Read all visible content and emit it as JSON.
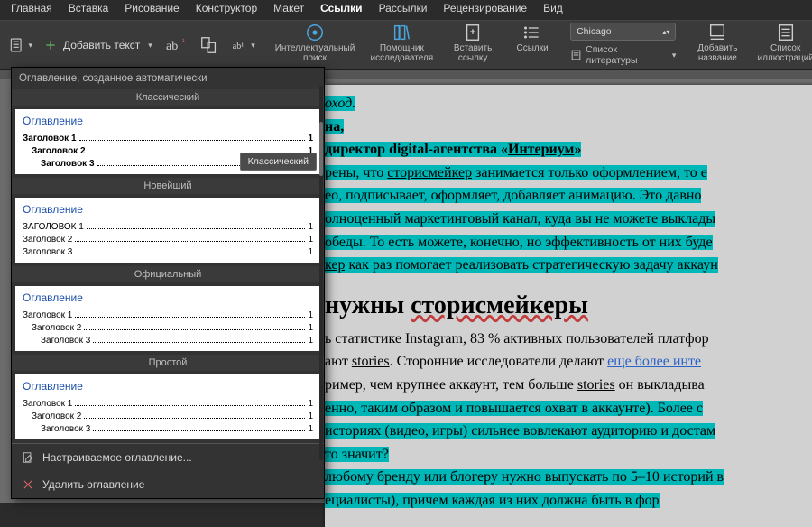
{
  "menubar": {
    "items": [
      "Главная",
      "Вставка",
      "Рисование",
      "Конструктор",
      "Макет",
      "Ссылки",
      "Рассылки",
      "Рецензирование",
      "Вид"
    ],
    "activeIndex": 5
  },
  "ribbon": {
    "addText": "Добавить текст",
    "smartLookup": "Интеллектуальный\nпоиск",
    "researcher": "Помощник\nисследователя",
    "insertCitation": "Вставить\nссылку",
    "citations": "Ссылки",
    "bibliographyStyle": "Chicago",
    "bibliographyList": "Список литературы",
    "insertCaption": "Добавить\nназвание",
    "tableOfFigures": "Список\nиллюстраций"
  },
  "toc": {
    "panelTitle": "Оглавление, созданное автоматически",
    "styles": [
      {
        "name": "Классический",
        "bold": true,
        "title": "Оглавление",
        "rows": [
          {
            "label": "Заголовок 1",
            "indent": 0
          },
          {
            "label": "Заголовок 2",
            "indent": 1
          },
          {
            "label": "Заголовок 3",
            "indent": 2
          }
        ],
        "tooltip": "Классический"
      },
      {
        "name": "Новейший",
        "bold": false,
        "title": "Оглавление",
        "allcaps": true,
        "rows": [
          {
            "label": "ЗАГОЛОВОК 1",
            "indent": 0
          },
          {
            "label": "Заголовок 2",
            "indent": 0
          },
          {
            "label": "Заголовок 3",
            "indent": 0
          }
        ]
      },
      {
        "name": "Официальный",
        "bold": false,
        "title": "Оглавление",
        "rows": [
          {
            "label": "Заголовок 1",
            "indent": 0
          },
          {
            "label": "Заголовок 2",
            "indent": 1
          },
          {
            "label": "Заголовок 3",
            "indent": 2
          }
        ]
      },
      {
        "name": "Простой",
        "bold": false,
        "title": "Оглавление",
        "rows": [
          {
            "label": "Заголовок 1",
            "indent": 0
          },
          {
            "label": "Заголовок 2",
            "indent": 1
          },
          {
            "label": "Заголовок 3",
            "indent": 2
          }
        ]
      }
    ],
    "custom": "Настраиваемое оглавление...",
    "remove": "Удалить оглавление"
  },
  "doc": {
    "l1": "оход.",
    "l2": "на,",
    "l3_a": " директор digital-агентства «",
    "l3_b": "Интериум",
    "l3_c": "»",
    "p1_a": "рены, что ",
    "p1_b": "сторисмейкер",
    "p1_c": " занимается только оформлением, то е",
    "p2": "ео, подписывает, оформляет, добавляет анимацию. Это давно ",
    "p3": "олноценный маркетинговый канал, куда вы не можете выклады",
    "p4": "обеды. То есть можете, конечно, но эффективность от них буде",
    "p5_a": "кер",
    "p5_b": " как раз помогает реализовать стратегическую задачу аккаун",
    "h2_a": "нужны ",
    "h2_b": "сторисмейкеры",
    "q1_a": "ь статистике Instagram, 83 % активных пользователей платфор",
    "q2_a": "ают ",
    "q2_b": "stories",
    "q2_c": ". Сторонние исследователи делают ",
    "q2_d": "еще более инте",
    "q3_a": "ример, чем крупнее аккаунт, тем больше ",
    "q3_b": "stories",
    "q3_c": " он выкладыва",
    "q4": "енно, таким образом и повышается охват в аккаунте). Более с",
    "q5": "историях (видео, игры) сильнее вовлекают аудиторию и достам",
    "q6": "то значит?",
    "q7": "любому бренду или блогеру нужно выпускать по 5–10 историй в",
    "q8": "ециалисты), причем каждая из них должна быть в фор"
  }
}
